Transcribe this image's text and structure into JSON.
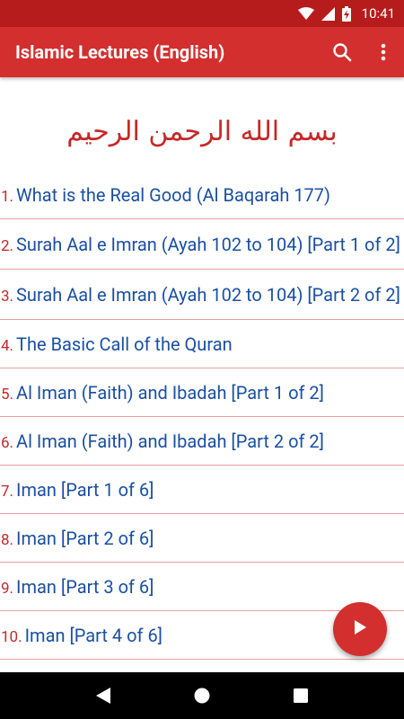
{
  "status_bar": {
    "time": "10:41",
    "icons": [
      "wifi-icon",
      "signal-icon",
      "battery-charging-icon"
    ]
  },
  "app_bar": {
    "title": "Islamic Lectures (English)",
    "actions": [
      "search-icon",
      "more-vert-icon"
    ]
  },
  "bismillah": "بسم الله الرحمن الرحيم",
  "lectures": [
    {
      "num": "1.",
      "title": "What is the Real Good (Al Baqarah 177)"
    },
    {
      "num": "2.",
      "title": "Surah Aal e Imran (Ayah 102 to 104) [Part 1 of 2]"
    },
    {
      "num": "3.",
      "title": "Surah Aal e Imran (Ayah 102 to 104) [Part 2 of 2]"
    },
    {
      "num": "4.",
      "title": "The Basic Call of the Quran"
    },
    {
      "num": "5.",
      "title": "Al Iman (Faith) and Ibadah [Part 1 of 2]"
    },
    {
      "num": "6.",
      "title": "Al Iman (Faith) and Ibadah [Part 2 of 2]"
    },
    {
      "num": "7.",
      "title": "Iman [Part 1 of 6]"
    },
    {
      "num": "8.",
      "title": "Iman [Part 2 of 6]"
    },
    {
      "num": "9.",
      "title": "Iman [Part 3 of 6]"
    },
    {
      "num": "10.",
      "title": "Iman [Part 4 of 6]"
    }
  ],
  "fab": {
    "icon": "play-icon"
  },
  "nav_bar": {
    "icons": [
      "back-icon",
      "home-icon",
      "recents-icon"
    ]
  },
  "colors": {
    "primary": "#d32f2f",
    "primary_dark": "#b71c1c",
    "title_blue": "#1a4fa3",
    "number_red": "#c62828"
  }
}
